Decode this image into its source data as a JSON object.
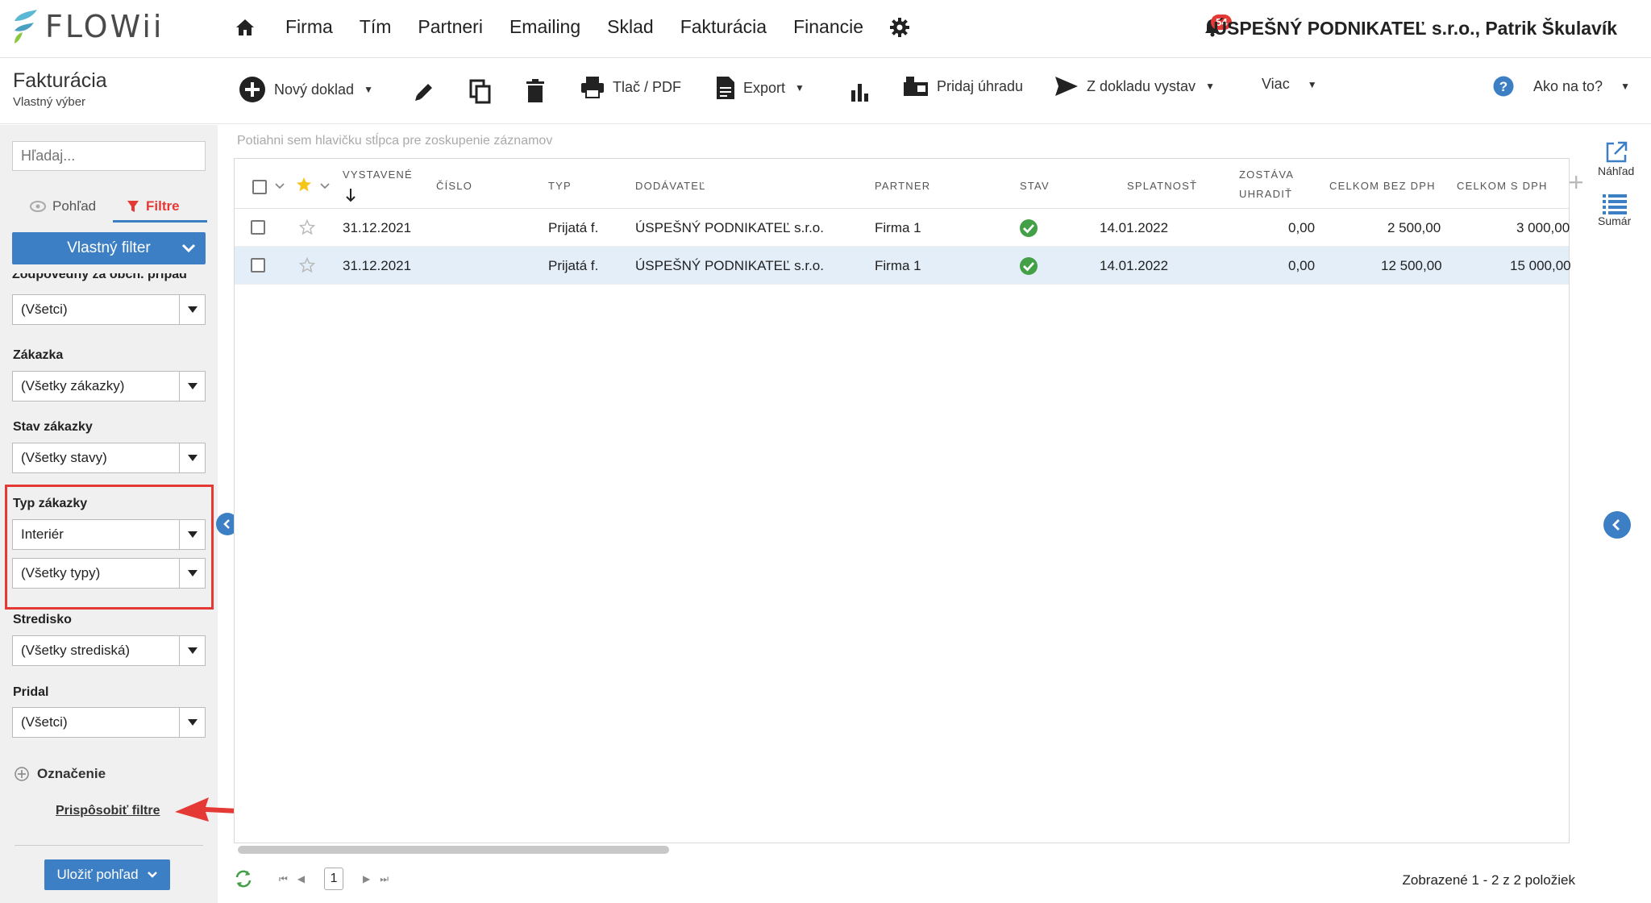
{
  "app": {
    "logo_text": "FLOWii"
  },
  "nav": {
    "items": [
      "Firma",
      "Tím",
      "Partneri",
      "Emailing",
      "Sklad",
      "Fakturácia",
      "Financie"
    ],
    "notifications": "54",
    "company": "ÚSPEŠNÝ PODNIKATEĽ s.r.o., Patrik Škulavík"
  },
  "page": {
    "title": "Fakturácia",
    "subtitle": "Vlastný výber"
  },
  "toolbar": {
    "new_doc": "Nový doklad",
    "print": "Tlač / PDF",
    "export": "Export",
    "add_payment": "Pridaj úhradu",
    "from_doc": "Z dokladu vystav",
    "more": "Viac",
    "help": "Ako na to?"
  },
  "sidebar": {
    "search_placeholder": "Hľadaj...",
    "tab_view": "Pohľad",
    "tab_filter": "Filtre",
    "custom_filter": "Vlastný filter",
    "clipped_label": "Zodpovedný za obch. prípad",
    "filters": [
      {
        "label": "",
        "value": "(Všetci)"
      },
      {
        "label": "Zákazka",
        "value": "(Všetky zákazky)"
      },
      {
        "label": "Stav zákazky",
        "value": "(Všetky stavy)"
      },
      {
        "label": "Typ zákazky",
        "value": "Interiér",
        "value2": "(Všetky typy)"
      },
      {
        "label": "Stredisko",
        "value": "(Všetky strediská)"
      },
      {
        "label": "Pridal",
        "value": "(Všetci)"
      }
    ],
    "marking": "Označenie",
    "customize": "Prispôsobiť filtre",
    "save_view": "Uložiť pohľad"
  },
  "grid": {
    "group_hint": "Potiahni sem hlavičku stĺpca pre zoskupenie záznamov",
    "columns": [
      "VYSTAVENÉ",
      "ČÍSLO",
      "TYP",
      "DODÁVATEĽ",
      "PARTNER",
      "STAV",
      "SPLATNOSŤ",
      "ZOSTÁVA",
      "UHRADIŤ",
      "CELKOM BEZ DPH",
      "CELKOM S DPH"
    ],
    "rows": [
      {
        "issued": "31.12.2021",
        "number": "",
        "type": "Prijatá f.",
        "supplier": "ÚSPEŠNÝ PODNIKATEĽ s.r.o.",
        "partner": "Firma 1",
        "status": "ok",
        "due": "14.01.2022",
        "remaining": "0,00",
        "net": "2 500,00",
        "gross": "3 000,00"
      },
      {
        "issued": "31.12.2021",
        "number": "",
        "type": "Prijatá f.",
        "supplier": "ÚSPEŠNÝ PODNIKATEĽ s.r.o.",
        "partner": "Firma 1",
        "status": "ok",
        "due": "14.01.2022",
        "remaining": "0,00",
        "net": "12 500,00",
        "gross": "15 000,00"
      }
    ]
  },
  "right_panel": {
    "preview": "Náhľad",
    "summary": "Sumár"
  },
  "pager": {
    "page": "1",
    "summary": "Zobrazené 1 - 2 z 2 položiek"
  },
  "colors": {
    "accent": "#3c7fc4",
    "alert": "#e53935",
    "ok": "#43a047"
  }
}
